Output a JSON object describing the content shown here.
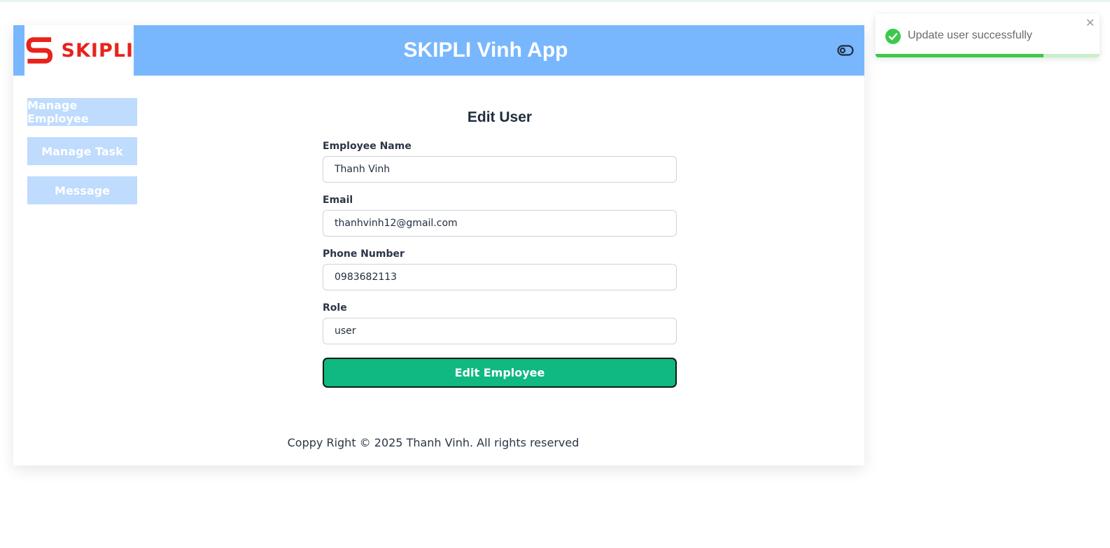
{
  "header": {
    "logo_text": "SKIPLI",
    "title": "SKIPLI Vinh App",
    "theme_toggle_icon": "toggle-icon"
  },
  "sidebar": {
    "items": [
      {
        "label": "Manage Employee"
      },
      {
        "label": "Manage Task"
      },
      {
        "label": "Message"
      }
    ]
  },
  "form": {
    "title": "Edit User",
    "fields": [
      {
        "label": "Employee Name",
        "value": "Thanh Vinh"
      },
      {
        "label": "Email",
        "value": "thanhvinh12@gmail.com"
      },
      {
        "label": "Phone Number",
        "value": "0983682113"
      },
      {
        "label": "Role",
        "value": "user"
      }
    ],
    "submit_label": "Edit Employee"
  },
  "footer": {
    "text": "Coppy Right © 2025 Thanh Vinh. All rights reserved"
  },
  "toast": {
    "message": "Update user successfully",
    "icon": "check-circle-icon",
    "close_icon": "close-icon",
    "progress_fraction": 0.75
  },
  "colors": {
    "header_bg": "#78b7fd",
    "sidebar_item_bg": "#bfdbfe",
    "submit_bg": "#10b981",
    "logo_red": "#e8231b",
    "toast_success": "#3cc94a"
  }
}
